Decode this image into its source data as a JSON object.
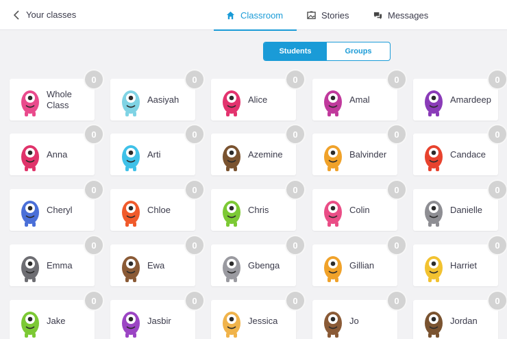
{
  "header": {
    "back_label": "Your classes",
    "nav": [
      {
        "label": "Classroom",
        "icon": "home-icon",
        "active": true
      },
      {
        "label": "Stories",
        "icon": "image-icon",
        "active": false
      },
      {
        "label": "Messages",
        "icon": "chat-icon",
        "active": false
      }
    ]
  },
  "toggle": {
    "students": "Students",
    "groups": "Groups",
    "selected": "Students"
  },
  "colors": {
    "accent": "#1a9bd7",
    "badge": "#d3d3d3"
  },
  "cards": [
    {
      "name": "Whole Class",
      "points": "0",
      "color": "#e94a8c"
    },
    {
      "name": "Aasiyah",
      "points": "0",
      "color": "#7fd3e4"
    },
    {
      "name": "Alice",
      "points": "0",
      "color": "#e3336e"
    },
    {
      "name": "Amal",
      "points": "0",
      "color": "#c0399c"
    },
    {
      "name": "Amardeep",
      "points": "0",
      "color": "#8a3bb8"
    },
    {
      "name": "Anna",
      "points": "0",
      "color": "#e0336a"
    },
    {
      "name": "Arti",
      "points": "0",
      "color": "#3fc1e8"
    },
    {
      "name": "Azemine",
      "points": "0",
      "color": "#7a5330"
    },
    {
      "name": "Balvinder",
      "points": "0",
      "color": "#f0a22a"
    },
    {
      "name": "Candace",
      "points": "0",
      "color": "#e8432e"
    },
    {
      "name": "Cheryl",
      "points": "0",
      "color": "#4a6fd8"
    },
    {
      "name": "Chloe",
      "points": "0",
      "color": "#f05a2b"
    },
    {
      "name": "Chris",
      "points": "0",
      "color": "#7cc934"
    },
    {
      "name": "Colin",
      "points": "0",
      "color": "#ea4d86"
    },
    {
      "name": "Danielle",
      "points": "0",
      "color": "#8e8e93"
    },
    {
      "name": "Emma",
      "points": "0",
      "color": "#6d6d72"
    },
    {
      "name": "Ewa",
      "points": "0",
      "color": "#8a5a36"
    },
    {
      "name": "Gbenga",
      "points": "0",
      "color": "#9a9aa0"
    },
    {
      "name": "Gillian",
      "points": "0",
      "color": "#f0a22a"
    },
    {
      "name": "Harriet",
      "points": "0",
      "color": "#f2c230"
    },
    {
      "name": "Jake",
      "points": "0",
      "color": "#7cc934"
    },
    {
      "name": "Jasbir",
      "points": "0",
      "color": "#9b45c4"
    },
    {
      "name": "Jessica",
      "points": "0",
      "color": "#f0b34a"
    },
    {
      "name": "Jo",
      "points": "0",
      "color": "#8a5a36"
    },
    {
      "name": "Jordan",
      "points": "0",
      "color": "#7a5330"
    }
  ]
}
